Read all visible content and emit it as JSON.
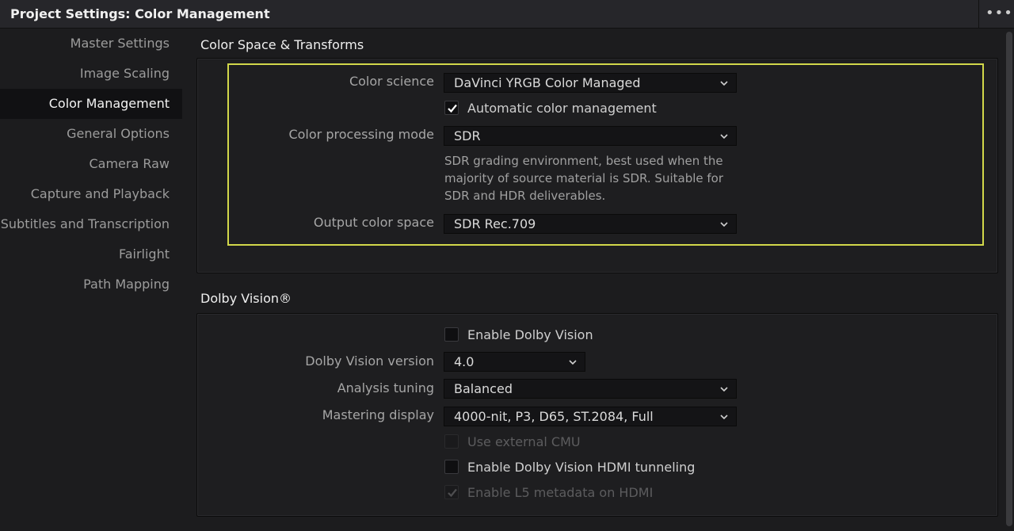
{
  "window": {
    "title": "Project Settings:  Color Management",
    "more_icon": "more-horizontal-icon"
  },
  "sidebar": {
    "items": [
      {
        "label": "Master Settings",
        "active": false
      },
      {
        "label": "Image Scaling",
        "active": false
      },
      {
        "label": "Color Management",
        "active": true
      },
      {
        "label": "General Options",
        "active": false
      },
      {
        "label": "Camera Raw",
        "active": false
      },
      {
        "label": "Capture and Playback",
        "active": false
      },
      {
        "label": "Subtitles and Transcription",
        "active": false
      },
      {
        "label": "Fairlight",
        "active": false
      },
      {
        "label": "Path Mapping",
        "active": false
      }
    ]
  },
  "color_space": {
    "title": "Color Space & Transforms",
    "color_science_label": "Color science",
    "color_science_value": "DaVinci YRGB Color Managed",
    "auto_color_label": "Automatic color management",
    "auto_color_checked": true,
    "processing_mode_label": "Color processing mode",
    "processing_mode_value": "SDR",
    "processing_mode_desc": "SDR grading environment, best used when the majority of source material is SDR. Suitable for SDR and HDR deliverables.",
    "output_space_label": "Output color space",
    "output_space_value": "SDR Rec.709"
  },
  "dolby": {
    "title": "Dolby Vision®",
    "enable_label": "Enable Dolby Vision",
    "enable_checked": false,
    "version_label": "Dolby Vision version",
    "version_value": "4.0",
    "analysis_label": "Analysis tuning",
    "analysis_value": "Balanced",
    "mastering_label": "Mastering display",
    "mastering_value": "4000-nit, P3, D65, ST.2084, Full",
    "external_cmu_label": "Use external CMU",
    "external_cmu_checked": false,
    "hdmi_label": "Enable Dolby Vision HDMI tunneling",
    "hdmi_checked": false,
    "l5_label": "Enable L5 metadata on HDMI",
    "l5_checked": true
  },
  "colors": {
    "accent_highlight": "#d2d84a",
    "background": "#1c1c1e"
  }
}
